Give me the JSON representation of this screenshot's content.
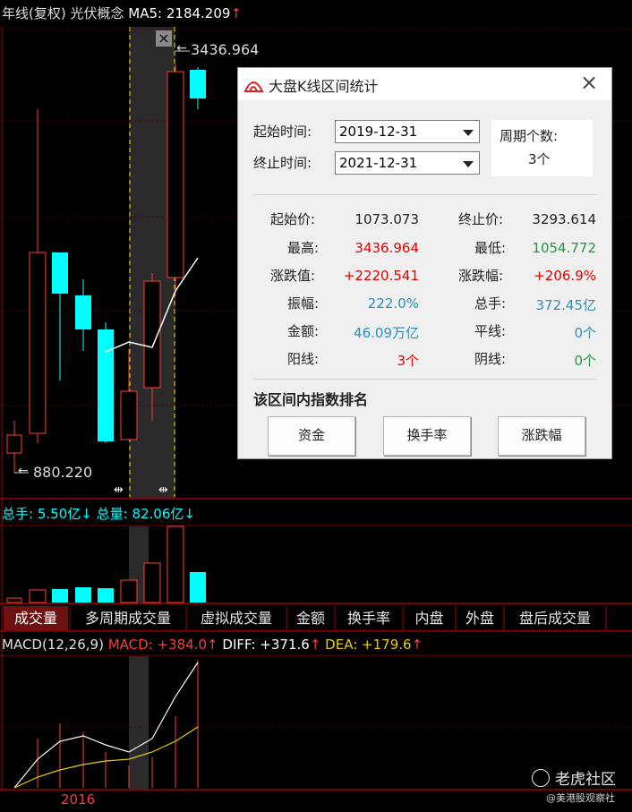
{
  "header": {
    "title": "年线(复权) 光伏概念",
    "ma_label": "MA5:",
    "ma_value": "2184.209",
    "ma_arrow": "↑"
  },
  "chart": {
    "high_label": "3436.964",
    "low_label": "880.220",
    "close_icon": "×",
    "range_markers": [
      "⇹",
      "⇹"
    ]
  },
  "volume": {
    "text_prefix": "总手:",
    "total_hands": "5.50亿",
    "hands_arrow": "↓",
    "text_mid": "总量:",
    "total_volume": "82.06亿",
    "volume_arrow": "↓"
  },
  "tabs": [
    "成交量",
    "多周期成交量",
    "虚拟成交量",
    "金额",
    "换手率",
    "内盘",
    "外盘",
    "盘后成交量"
  ],
  "macd": {
    "params": "MACD(12,26,9)",
    "macd_label": "MACD:",
    "macd_value": "+384.0",
    "diff_label": "DIFF:",
    "diff_value": "+371.6",
    "dea_label": "DEA:",
    "dea_value": "+179.6",
    "arrow": "↑",
    "year_label": "2016"
  },
  "dialog": {
    "title": "大盘K线区间统计",
    "start_label": "起始时间:",
    "start_value": "2019-12-31",
    "end_label": "终止时间:",
    "end_value": "2021-12-31",
    "period_label": "周期个数:",
    "period_value": "3个",
    "stats": {
      "open_label": "起始价:",
      "open_value": "1073.073",
      "close_label": "终止价:",
      "close_value": "3293.614",
      "high_label": "最高:",
      "high_value": "3436.964",
      "low_label": "最低:",
      "low_value": "1054.772",
      "chg_label": "涨跌值:",
      "chg_value": "+2220.541",
      "chgpct_label": "涨跌幅:",
      "chgpct_value": "+206.9%",
      "amp_label": "振幅:",
      "amp_value": "222.0%",
      "hands_label": "总手:",
      "hands_value": "372.45亿",
      "amount_label": "金额:",
      "amount_value": "46.09万亿",
      "flat_label": "平线:",
      "flat_value": "0个",
      "yang_label": "阳线:",
      "yang_value": "3个",
      "yin_label": "阴线:",
      "yin_value": "0个"
    },
    "rank_title": "该区间内指数排名",
    "buttons": [
      "资金",
      "换手率",
      "涨跌幅"
    ]
  },
  "watermark": {
    "brand": "老虎社区",
    "handle": "@美港股观察社"
  },
  "colors": {
    "up": "#ff3c3c",
    "down": "#00ffff",
    "green": "#1d9a3c",
    "blue": "#2a8fbf",
    "grid": "#8b0000",
    "highlight": "#2e2e2e",
    "dashed": "#ffd400"
  }
}
